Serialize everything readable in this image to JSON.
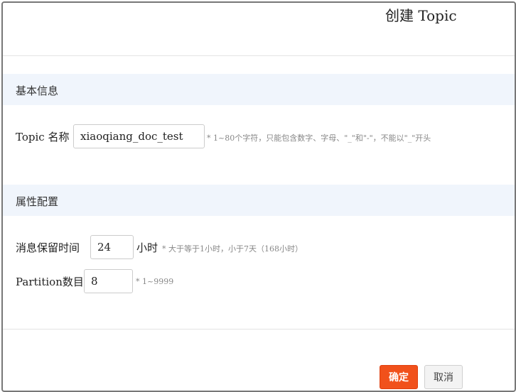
{
  "dialog": {
    "title": "创建 Topic"
  },
  "basic_section": {
    "heading": "基本信息",
    "topic_name": {
      "label": "Topic 名称",
      "value": "xiaoqiang_doc_test",
      "hint": "* 1~80个字符，只能包含数字、字母、\"_\"和\"-\"，不能以\"_\"开头"
    }
  },
  "config_section": {
    "heading": "属性配置",
    "retention": {
      "label": "消息保留时间",
      "value": "24",
      "unit": "小时",
      "hint": "* 大于等于1小时，小于7天（168小时）"
    },
    "partition": {
      "label": "Partition数目",
      "value": "8",
      "hint": "* 1~9999"
    }
  },
  "footer": {
    "confirm_label": "确定",
    "cancel_label": "取消"
  },
  "colors": {
    "confirm": "#f1511b",
    "section_bg": "#f0f5fc"
  }
}
